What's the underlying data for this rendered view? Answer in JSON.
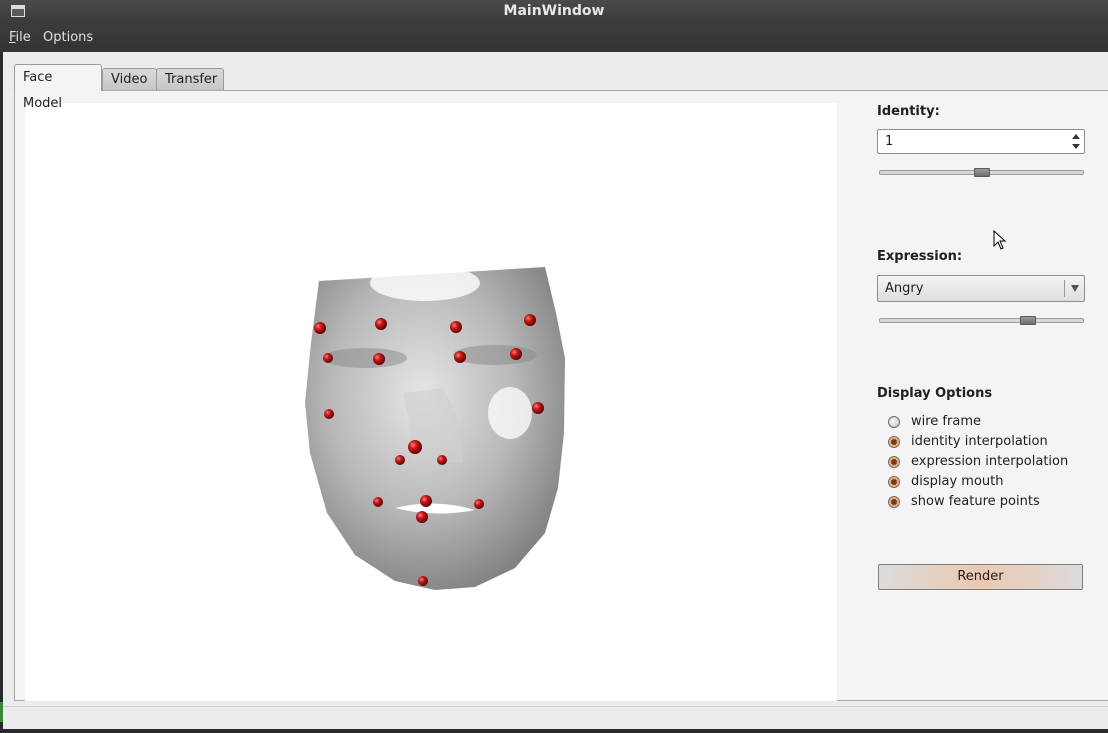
{
  "window": {
    "title": "MainWindow"
  },
  "menu": {
    "file_mnemonic": "F",
    "file_rest": "ile",
    "options": "Options"
  },
  "tabs": [
    {
      "label": "Face Model",
      "active": true
    },
    {
      "label": "Video",
      "active": false
    },
    {
      "label": "Transfer",
      "active": false
    }
  ],
  "identity": {
    "label": "Identity:",
    "value": "1",
    "slider_fraction": 0.5
  },
  "expression": {
    "label": "Expression:",
    "selected": "Angry",
    "slider_fraction": 0.73
  },
  "display_options": {
    "label": "Display Options",
    "items": [
      {
        "label": "wire frame",
        "checked": false
      },
      {
        "label": "identity interpolation",
        "checked": true
      },
      {
        "label": "expression interpolation",
        "checked": true
      },
      {
        "label": "display mouth",
        "checked": true
      },
      {
        "label": "show feature points",
        "checked": true
      }
    ]
  },
  "render_button": {
    "label": "Render"
  },
  "icons": {
    "window": "window-icon",
    "cursor": "mouse-pointer-icon",
    "spin": "spin-arrows-icon",
    "dropdown": "dropdown-arrow-icon"
  },
  "colors": {
    "feature_point": "#b01010",
    "accent": "#e8b898"
  }
}
